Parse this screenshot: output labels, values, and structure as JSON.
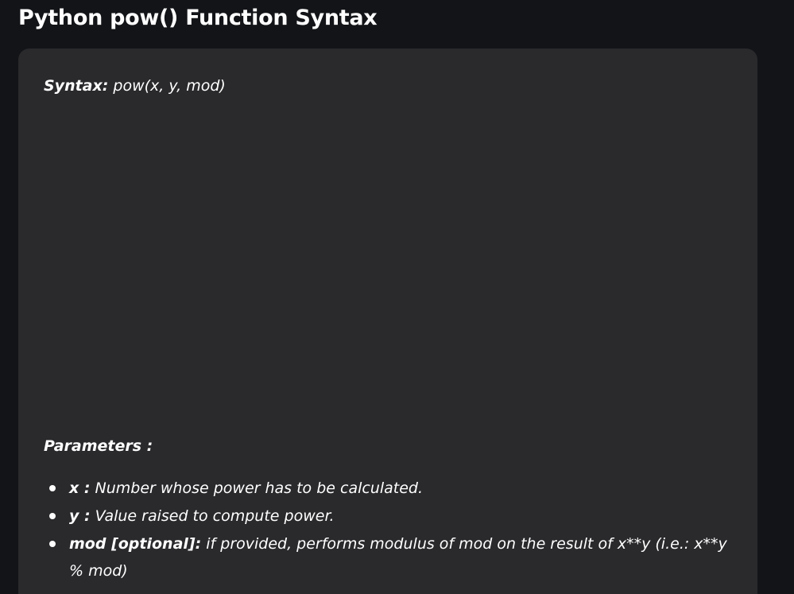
{
  "page": {
    "title": "Python pow() Function Syntax"
  },
  "syntax": {
    "label": "Syntax:",
    "signature": "pow(x, y, mod)"
  },
  "parameters": {
    "heading": "Parameters :",
    "items": [
      {
        "term": "x :",
        "description": "Number whose power has to be calculated."
      },
      {
        "term": "y :",
        "description": "Value raised to compute power."
      },
      {
        "term": "mod [optional]:",
        "description": "if provided, performs modulus of mod on the result of x**y (i.e.: x**y % mod)"
      }
    ]
  },
  "colors": {
    "background": "#131417",
    "card": "#2a2a2d",
    "text": "#ffffff"
  }
}
